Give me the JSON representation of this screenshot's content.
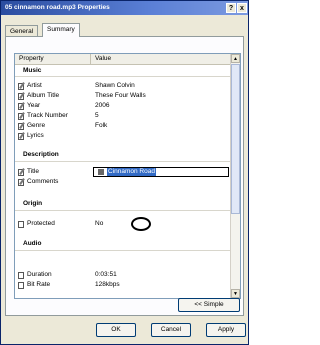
{
  "window": {
    "title": "05 cinnamon road.mp3 Properties",
    "help": "?",
    "close": "x"
  },
  "tabs": [
    "General",
    "Summary"
  ],
  "list": {
    "headers": {
      "property": "Property",
      "value": "Value"
    },
    "groups": {
      "music": "Music",
      "description": "Description",
      "origin": "Origin",
      "audio": "Audio"
    },
    "music_rows": [
      {
        "name": "Artist",
        "value": "Shawn Colvin"
      },
      {
        "name": "Album Title",
        "value": "These Four Walls"
      },
      {
        "name": "Year",
        "value": "2006"
      },
      {
        "name": "Track Number",
        "value": "5"
      },
      {
        "name": "Genre",
        "value": "Folk"
      },
      {
        "name": "Lyrics",
        "value": ""
      }
    ],
    "description_rows": [
      {
        "name": "Title",
        "value": "Cinnamon Road"
      },
      {
        "name": "Comments",
        "value": ""
      }
    ],
    "origin_rows": [
      {
        "name": "Protected",
        "value": "No"
      }
    ],
    "audio_rows": [
      {
        "name": "Duration",
        "value": "0:03:51"
      },
      {
        "name": "Bit Rate",
        "value": "128kbps"
      }
    ]
  },
  "buttons": {
    "simple": "<< Simple",
    "ok": "OK",
    "cancel": "Cancel",
    "apply": "Apply"
  }
}
